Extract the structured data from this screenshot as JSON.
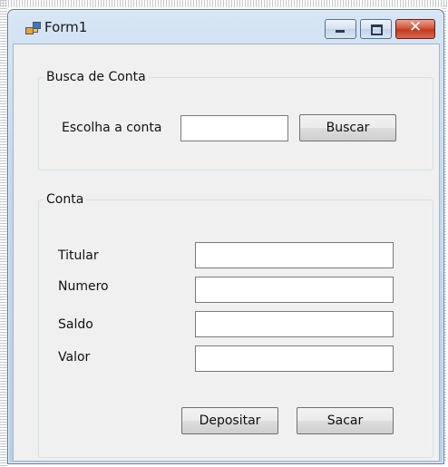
{
  "window": {
    "title": "Form1",
    "icon": "winforms-app-icon",
    "controls": {
      "minimize_icon": "minimize-icon",
      "maximize_icon": "maximize-icon",
      "close_glyph": "✕"
    }
  },
  "busca": {
    "group_title": "Busca de Conta",
    "label": "Escolha a conta",
    "input_value": "",
    "button": "Buscar"
  },
  "conta": {
    "group_title": "Conta",
    "fields": [
      {
        "label": "Titular",
        "value": ""
      },
      {
        "label": "Numero",
        "value": ""
      },
      {
        "label": "Saldo",
        "value": ""
      },
      {
        "label": "Valor",
        "value": ""
      }
    ],
    "buttons": {
      "depositar": "Depositar",
      "sacar": "Sacar"
    }
  }
}
